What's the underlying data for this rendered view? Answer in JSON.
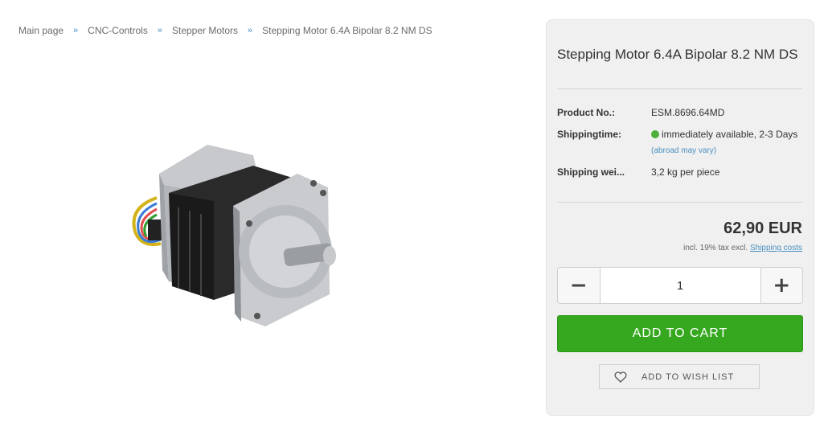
{
  "breadcrumb": {
    "items": [
      "Main page",
      "CNC-Controls",
      "Stepper Motors",
      "Stepping Motor 6.4A Bipolar 8.2 NM DS"
    ],
    "separator": "»"
  },
  "product_image": {
    "icon": "stepper-motor-photo"
  },
  "buybox": {
    "title": "Stepping Motor 6.4A Bipolar 8.2 NM DS",
    "properties": [
      {
        "label": "Product No.:",
        "value": "ESM.8696.64MD"
      },
      {
        "label": "Shippingtime:",
        "value": "immediately available, 2-3 Days",
        "note": "(abroad may vary)"
      },
      {
        "label": "Shipping wei...",
        "value": "3,2 kg per piece"
      }
    ],
    "availability_color": "#4caf3a",
    "price": "62,90 EUR",
    "tax_text": "incl. 19% tax excl.",
    "shipping_link": "Shipping costs",
    "quantity": {
      "minus": "−",
      "value": "1",
      "plus": "+"
    },
    "add_to_cart": "ADD TO CART",
    "add_to_cart_color": "#36a81f",
    "wish_list": "ADD TO WISH LIST"
  }
}
